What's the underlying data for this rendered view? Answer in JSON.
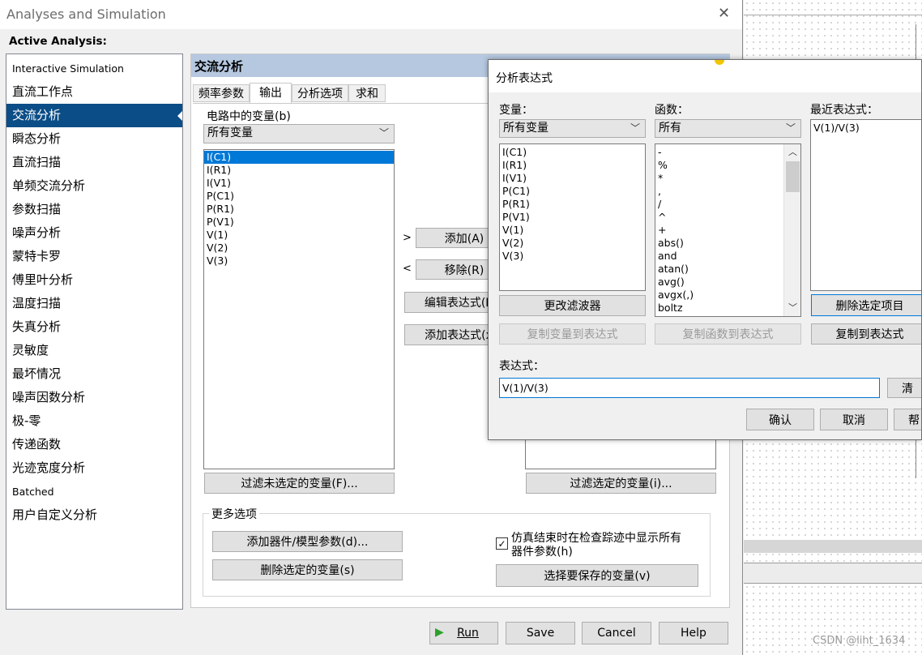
{
  "window": {
    "title": "Analyses and Simulation",
    "close_glyph": "✕"
  },
  "active_analysis_label": "Active Analysis:",
  "nav": [
    {
      "label": "Interactive Simulation",
      "small": true
    },
    {
      "label": "直流工作点"
    },
    {
      "label": "交流分析",
      "selected": true
    },
    {
      "label": "瞬态分析"
    },
    {
      "label": "直流扫描"
    },
    {
      "label": "单频交流分析"
    },
    {
      "label": "参数扫描"
    },
    {
      "label": "噪声分析"
    },
    {
      "label": "蒙特卡罗"
    },
    {
      "label": "傅里叶分析"
    },
    {
      "label": "温度扫描"
    },
    {
      "label": "失真分析"
    },
    {
      "label": "灵敏度"
    },
    {
      "label": "最坏情况"
    },
    {
      "label": "噪声因数分析"
    },
    {
      "label": "极-零"
    },
    {
      "label": "传递函数"
    },
    {
      "label": "光迹宽度分析"
    },
    {
      "label": "Batched",
      "small": true
    },
    {
      "label": "用户自定义分析"
    }
  ],
  "panel": {
    "header": "交流分析",
    "tabs": [
      "频率参数",
      "输出",
      "分析选项",
      "求和"
    ],
    "active_tab": 1,
    "circuit_vars_label": "电路中的变量(b)",
    "filter_combo": "所有变量",
    "variables": [
      "I(C1)",
      "I(R1)",
      "I(V1)",
      "P(C1)",
      "P(R1)",
      "P(V1)",
      "V(1)",
      "V(2)",
      "V(3)"
    ],
    "selected_index": 0,
    "add_arrow": ">",
    "add_button": "添加(A)",
    "remove_arrow": "<",
    "remove_button": "移除(R)",
    "edit_expr_button": "编辑表达式(E",
    "add_expr_button": "添加表达式(x",
    "filter_unselected_button": "过滤未选定的变量(F)...",
    "filter_selected_button": "过滤选定的变量(i)...",
    "more_options_label": "更多选项",
    "add_device_param_button": "添加器件/模型参数(d)...",
    "delete_selected_var_button": "删除选定的变量(s)",
    "show_all_checkbox_label_1": "仿真结束时在检查踪迹中显示所有",
    "show_all_checkbox_label_2": "器件参数(h)",
    "show_all_checked": true,
    "select_save_vars_button": "选择要保存的变量(v)"
  },
  "footer": {
    "run": "Run",
    "save": "Save",
    "cancel": "Cancel",
    "help": "Help"
  },
  "dialog": {
    "title": "分析表达式",
    "variables_label": "变量：",
    "var_filter": "所有变量",
    "variables": [
      "I(C1)",
      "I(R1)",
      "I(V1)",
      "P(C1)",
      "P(R1)",
      "P(V1)",
      "V(1)",
      "V(2)",
      "V(3)"
    ],
    "functions_label": "函数：",
    "func_filter": "所有",
    "functions": [
      "-",
      "%",
      "*",
      ",",
      "/",
      "^",
      "+",
      "abs()",
      "and",
      "atan()",
      "avg()",
      "avgx(,)",
      "boltz"
    ],
    "recent_label": "最近表达式：",
    "recent": [
      "V(1)/V(3)"
    ],
    "change_filter_button": "更改滤波器",
    "copy_var_button": "复制变量到表达式",
    "copy_func_button": "复制函数到表达式",
    "delete_selected_item_button": "删除选定项目",
    "copy_to_expr_button": "复制到表达式",
    "expression_label": "表达式：",
    "expression_value": "V(1)/V(3)",
    "clear_button": "清",
    "ok_button": "确认",
    "cancel_button": "取消",
    "help_button": "帮"
  },
  "watermark": "CSDN @liht_1634"
}
